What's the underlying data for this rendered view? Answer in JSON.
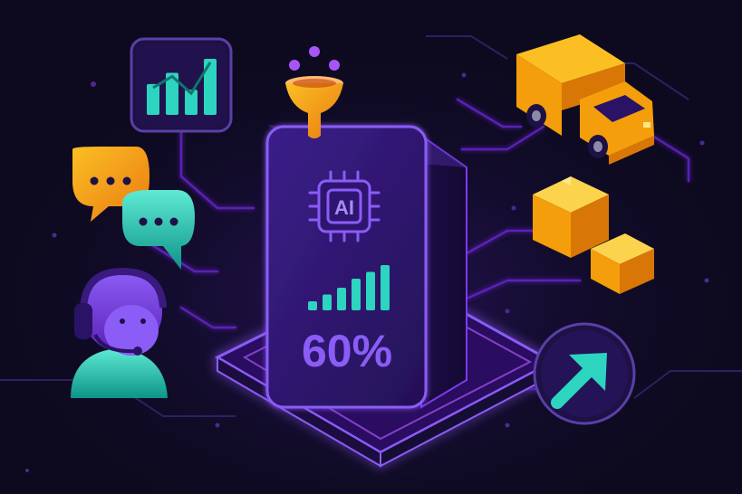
{
  "colors": {
    "background": "#0d0a1f",
    "primary_purple": "#7c3aed",
    "glow_purple": "#a855f7",
    "accent_teal": "#2dd4bf",
    "accent_orange": "#f59e0b",
    "panel_dark": "#1e1145"
  },
  "icons": {
    "bar_chart": "bar-chart-icon",
    "speech_bubble_orange": "chat-bubble-icon",
    "speech_bubble_teal": "chat-bubble-icon",
    "support_agent": "headset-agent-icon",
    "funnel": "funnel-icon",
    "ai_chip": "ai-chip-icon",
    "signal_bars": "signal-bars-icon",
    "delivery_truck": "truck-icon",
    "boxes": "package-boxes-icon",
    "arrow": "arrow-up-right-icon"
  },
  "device": {
    "chip_label": "AI",
    "metric_value": "60%",
    "signal_levels": [
      0.2,
      0.35,
      0.5,
      0.7,
      0.85,
      1.0
    ]
  },
  "bar_chart_levels": [
    0.55,
    0.75,
    0.45,
    1.0
  ]
}
